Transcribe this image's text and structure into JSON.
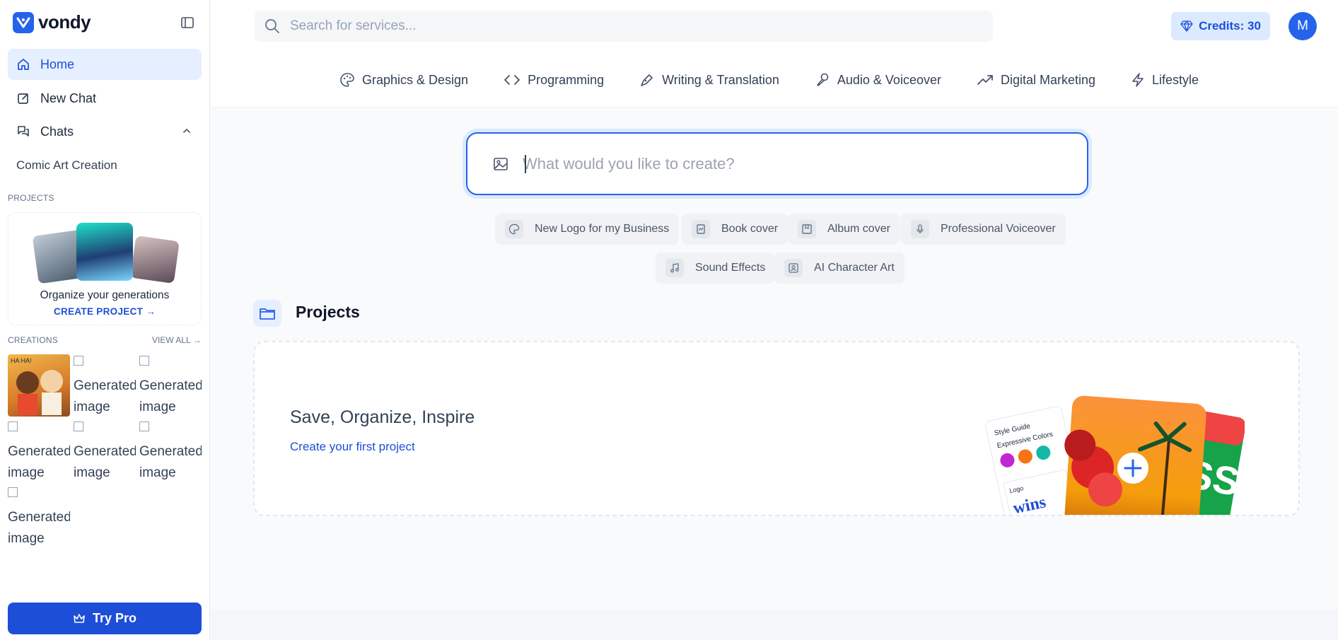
{
  "brand": {
    "name": "vondy"
  },
  "sidebar": {
    "nav": [
      {
        "label": "Home"
      },
      {
        "label": "New Chat"
      },
      {
        "label": "Chats"
      }
    ],
    "chats": [
      {
        "label": "Comic Art Creation"
      }
    ],
    "projects_label": "PROJECTS",
    "projects_card": {
      "title": "Organize your generations",
      "cta": "CREATE PROJECT"
    },
    "creations_label": "CREATIONS",
    "view_all": "VIEW ALL",
    "creations": [
      {
        "alt": ""
      },
      {
        "alt": "Generated image"
      },
      {
        "alt": "Generated image"
      },
      {
        "alt": "Generated image"
      },
      {
        "alt": "Generated image"
      },
      {
        "alt": "Generated image"
      },
      {
        "alt": "Generated image"
      }
    ],
    "try_pro": "Try Pro"
  },
  "header": {
    "search_placeholder": "Search for services...",
    "credits": "Credits: 30",
    "avatar_initial": "M",
    "categories": [
      {
        "label": "Graphics & Design",
        "icon": "palette-icon"
      },
      {
        "label": "Programming",
        "icon": "code-icon"
      },
      {
        "label": "Writing & Translation",
        "icon": "pen-icon"
      },
      {
        "label": "Audio & Voiceover",
        "icon": "microphone-icon"
      },
      {
        "label": "Digital Marketing",
        "icon": "trending-up-icon"
      },
      {
        "label": "Lifestyle",
        "icon": "lightning-icon"
      }
    ]
  },
  "main": {
    "prompt_placeholder": "What would you like to create?",
    "suggestions": [
      {
        "label": "New Logo for my Business"
      },
      {
        "label": "Book cover"
      },
      {
        "label": "Album cover"
      },
      {
        "label": "Professional Voiceover"
      },
      {
        "label": "Sound Effects"
      },
      {
        "label": "AI Character Art"
      }
    ],
    "projects": {
      "heading": "Projects",
      "title": "Save, Organize, Inspire",
      "link": "Create your first project",
      "illustration": {
        "card_title": "Style Guide",
        "card_subtitle": "Expressive Colors",
        "card_logo_label": "Logo",
        "card_logo_text": "wins",
        "side_text": "SS"
      }
    }
  },
  "colors": {
    "accent": "#2563eb",
    "accent_light": "#dbeafe"
  }
}
